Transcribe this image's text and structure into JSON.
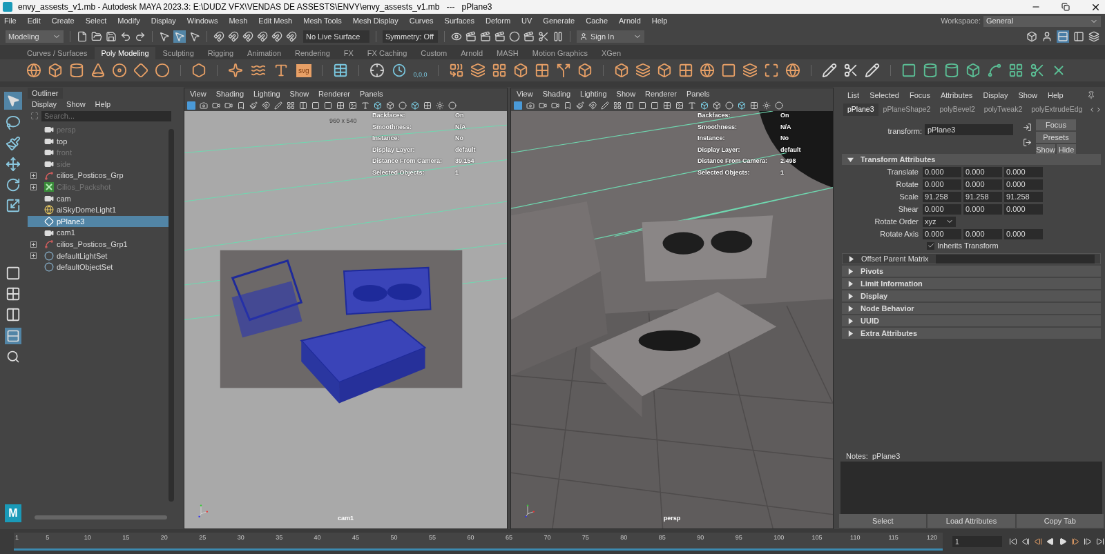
{
  "window": {
    "title": "envy_assests_v1.mb - Autodesk MAYA 2023.3: E:\\DUDZ VFX\\VENDAS DE ASSESTS\\ENVY\\envy_assests_v1.mb   ---   pPlane3"
  },
  "menu_bar": [
    "File",
    "Edit",
    "Create",
    "Select",
    "Modify",
    "Display",
    "Windows",
    "Mesh",
    "Edit Mesh",
    "Mesh Tools",
    "Mesh Display",
    "Curves",
    "Surfaces",
    "Deform",
    "UV",
    "Generate",
    "Cache",
    "Arnold",
    "Help"
  ],
  "workspace": {
    "label": "Workspace:",
    "value": "General"
  },
  "status_line": {
    "mode": "Modeling",
    "live_surface": "No Live Surface",
    "symmetry": "Symmetry: Off",
    "sign_in": "Sign In"
  },
  "shelf_tabs": [
    {
      "label": "Curves / Surfaces",
      "selected": false
    },
    {
      "label": "Poly Modeling",
      "selected": true
    },
    {
      "label": "Sculpting",
      "selected": false
    },
    {
      "label": "Rigging",
      "selected": false
    },
    {
      "label": "Animation",
      "selected": false
    },
    {
      "label": "Rendering",
      "selected": false
    },
    {
      "label": "FX",
      "selected": false
    },
    {
      "label": "FX Caching",
      "selected": false
    },
    {
      "label": "Custom",
      "selected": false
    },
    {
      "label": "Arnold",
      "selected": false
    },
    {
      "label": "MASH",
      "selected": false
    },
    {
      "label": "Motion Graphics",
      "selected": false
    },
    {
      "label": "XGen",
      "selected": false
    }
  ],
  "shelf": {
    "svg_badge": "svg",
    "origin_badge": "0,0,0"
  },
  "logo": "M",
  "outliner": {
    "title": "Outliner",
    "menu": [
      "Display",
      "Show",
      "Help"
    ],
    "search_placeholder": "Search...",
    "items": [
      {
        "label": "persp",
        "kind": "camera",
        "dimmed": true,
        "expandable": false,
        "selected": false
      },
      {
        "label": "top",
        "kind": "camera",
        "dimmed": false,
        "expandable": false,
        "selected": false
      },
      {
        "label": "front",
        "kind": "camera",
        "dimmed": true,
        "expandable": false,
        "selected": false
      },
      {
        "label": "side",
        "kind": "camera",
        "dimmed": true,
        "expandable": false,
        "selected": false
      },
      {
        "label": "cilios_Posticos_Grp",
        "kind": "group",
        "dimmed": false,
        "expandable": true,
        "selected": false
      },
      {
        "label": "Cilios_Packshot",
        "kind": "packshot",
        "dimmed": true,
        "expandable": true,
        "selected": false
      },
      {
        "label": "cam",
        "kind": "camera",
        "dimmed": false,
        "expandable": false,
        "selected": false
      },
      {
        "label": "aiSkyDomeLight1",
        "kind": "light",
        "dimmed": false,
        "expandable": false,
        "selected": false
      },
      {
        "label": "pPlane3",
        "kind": "plane",
        "dimmed": false,
        "expandable": false,
        "selected": true
      },
      {
        "label": "cam1",
        "kind": "camera",
        "dimmed": false,
        "expandable": false,
        "selected": false
      },
      {
        "label": "cilios_Posticos_Grp1",
        "kind": "group",
        "dimmed": false,
        "expandable": true,
        "selected": false
      },
      {
        "label": "defaultLightSet",
        "kind": "set",
        "dimmed": false,
        "expandable": true,
        "selected": false
      },
      {
        "label": "defaultObjectSet",
        "kind": "set",
        "dimmed": false,
        "expandable": false,
        "selected": false
      }
    ]
  },
  "viewports": [
    {
      "kind": "wireframe",
      "menu": [
        "View",
        "Shading",
        "Lighting",
        "Show",
        "Renderer",
        "Panels"
      ],
      "resolution": "960 x 540",
      "camera": "cam1",
      "hud": [
        {
          "label": "Backfaces:",
          "value": "On"
        },
        {
          "label": "Smoothness:",
          "value": "N/A"
        },
        {
          "label": "Instance:",
          "value": "No"
        },
        {
          "label": "Display Layer:",
          "value": "default"
        },
        {
          "label": "Distance From Camera:",
          "value": "39.154"
        },
        {
          "label": "Selected Objects:",
          "value": "1"
        }
      ]
    },
    {
      "kind": "shaded",
      "menu": [
        "View",
        "Shading",
        "Lighting",
        "Show",
        "Renderer",
        "Panels"
      ],
      "camera": "persp",
      "hud": [
        {
          "label": "Backfaces:",
          "value": "On"
        },
        {
          "label": "Smoothness:",
          "value": "N/A"
        },
        {
          "label": "Instance:",
          "value": "No"
        },
        {
          "label": "Display Layer:",
          "value": "default"
        },
        {
          "label": "Distance From Camera:",
          "value": "2.498"
        },
        {
          "label": "Selected Objects:",
          "value": "1"
        }
      ]
    }
  ],
  "attribute_editor": {
    "menu": [
      "List",
      "Selected",
      "Focus",
      "Attributes",
      "Display",
      "Show",
      "Help"
    ],
    "tabs": [
      {
        "label": "pPlane3",
        "selected": true
      },
      {
        "label": "pPlaneShape2",
        "selected": false
      },
      {
        "label": "polyBevel2",
        "selected": false
      },
      {
        "label": "polyTweak2",
        "selected": false
      },
      {
        "label": "polyExtrudeEdg",
        "selected": false
      }
    ],
    "transform_label": "transform:",
    "transform_value": "pPlane3",
    "buttons": [
      "Focus",
      "Presets",
      "Show",
      "Hide"
    ],
    "sections": [
      {
        "title": "Transform Attributes",
        "expanded": true,
        "rows": [
          {
            "kind": "vector",
            "label": "Translate",
            "values": [
              "0.000",
              "0.000",
              "0.000"
            ]
          },
          {
            "kind": "vector",
            "label": "Rotate",
            "values": [
              "0.000",
              "0.000",
              "0.000"
            ]
          },
          {
            "kind": "vector",
            "label": "Scale",
            "values": [
              "91.258",
              "91.258",
              "91.258"
            ]
          },
          {
            "kind": "vector",
            "label": "Shear",
            "values": [
              "0.000",
              "0.000",
              "0.000"
            ]
          },
          {
            "kind": "dropdown",
            "label": "Rotate Order",
            "value": "xyz"
          },
          {
            "kind": "vector",
            "label": "Rotate Axis",
            "values": [
              "0.000",
              "0.000",
              "0.000"
            ]
          },
          {
            "kind": "checkbox",
            "label": "Inherits Transform",
            "checked": true
          }
        ]
      },
      {
        "title": "Offset Parent Matrix",
        "expanded": false,
        "field": true
      },
      {
        "title": "Pivots",
        "expanded": false
      },
      {
        "title": "Limit Information",
        "expanded": false
      },
      {
        "title": "Display",
        "expanded": false
      },
      {
        "title": "Node Behavior",
        "expanded": false
      },
      {
        "title": "UUID",
        "expanded": false
      },
      {
        "title": "Extra Attributes",
        "expanded": false
      }
    ],
    "notes_label": "Notes:  pPlane3",
    "footer_buttons": [
      "Select",
      "Load Attributes",
      "Copy Tab"
    ]
  },
  "timeline": {
    "ticks": [
      "1",
      "5",
      "10",
      "15",
      "20",
      "25",
      "30",
      "35",
      "40",
      "45",
      "50",
      "55",
      "60",
      "65",
      "70",
      "75",
      "80",
      "85",
      "90",
      "95",
      "100",
      "105",
      "110",
      "115",
      "120"
    ],
    "current_frame": "1"
  }
}
